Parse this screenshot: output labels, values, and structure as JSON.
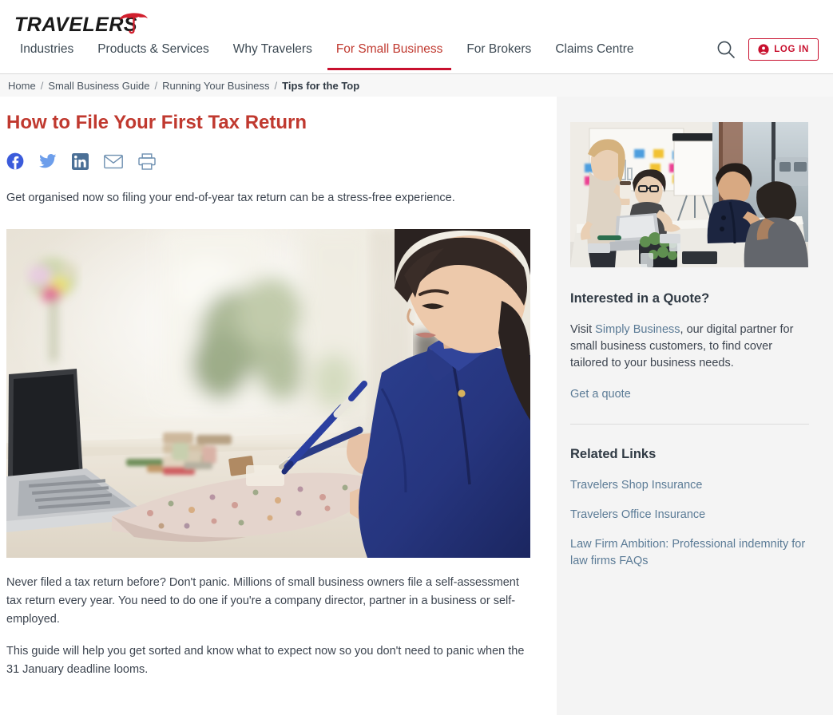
{
  "header": {
    "logo_text": "TRAVELERS",
    "logo_icon": "umbrella-icon",
    "nav_items": [
      {
        "label": "Industries",
        "active": false
      },
      {
        "label": "Products & Services",
        "active": false
      },
      {
        "label": "Why Travelers",
        "active": false
      },
      {
        "label": "For Small Business",
        "active": true
      },
      {
        "label": "For Brokers",
        "active": false
      },
      {
        "label": "Claims Centre",
        "active": false
      }
    ],
    "search_icon": "search-icon",
    "login_label": "LOG IN",
    "login_icon": "user-circle-icon",
    "accent_color": "#c8102e"
  },
  "breadcrumb": {
    "separator": "/",
    "items": [
      {
        "label": "Home",
        "current": false
      },
      {
        "label": "Small Business Guide",
        "current": false
      },
      {
        "label": "Running Your Business",
        "current": false
      },
      {
        "label": "Tips for the Top",
        "current": true
      }
    ]
  },
  "article": {
    "title": "How to File Your First Tax Return",
    "share": [
      {
        "name": "facebook-icon",
        "label": "Share on Facebook",
        "color": "#3b5998"
      },
      {
        "name": "twitter-icon",
        "label": "Share on Twitter",
        "color": "#6d9eeb"
      },
      {
        "name": "linkedin-icon",
        "label": "Share on LinkedIn",
        "color": "#4a6f96"
      },
      {
        "name": "email-icon",
        "label": "Share by Email",
        "color": "#6d8fb0"
      },
      {
        "name": "print-icon",
        "label": "Print this page",
        "color": "#6d8fb0"
      }
    ],
    "intro": "Get organised now so filing your end-of-year tax return can be a stress-free experience.",
    "hero_image_alt": "Woman in blue shirt writing notes at a desk beside a laptop and fabric samples",
    "paragraphs": [
      "Never filed a tax return before? Don't panic. Millions of small business owners file a self-assessment tax return every year. You need to do one if you're a company director, partner in a business or self-employed.",
      "This guide will help you get sorted and know what to expect now so you don't need to panic when the 31 January deadline looms."
    ]
  },
  "sidebar": {
    "image_alt": "Four colleagues meeting around a table in a bright office with a flip chart",
    "quote": {
      "heading": "Interested in a Quote?",
      "text_before": "Visit ",
      "link_text": "Simply Business",
      "text_after": ", our digital partner for small business customers, to find cover tailored to your business needs.",
      "cta_label": "Get a quote"
    },
    "related": {
      "heading": "Related Links",
      "links": [
        "Travelers Shop Insurance",
        "Travelers Office Insurance",
        "Law Firm Ambition: Professional indemnity for law firms FAQs"
      ]
    }
  }
}
